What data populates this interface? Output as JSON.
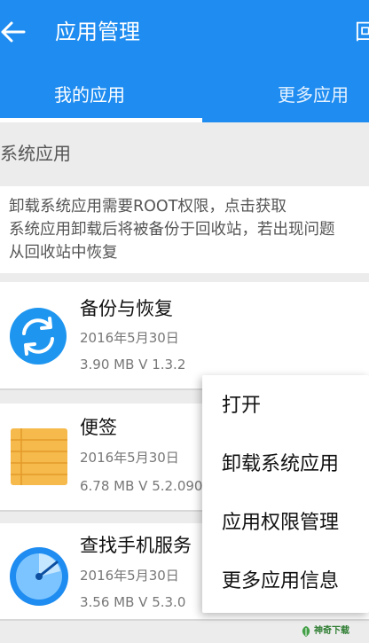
{
  "header": {
    "title": "应用管理",
    "right_action": "回",
    "back_icon": "arrow-left-icon"
  },
  "tabs": [
    {
      "label": "我的应用",
      "selected": true
    },
    {
      "label": "更多应用",
      "selected": false
    }
  ],
  "section": {
    "title": "系统应用"
  },
  "notice": {
    "line1": "卸载系统应用需要ROOT权限，点击获取",
    "line2": "系统应用卸载后将被备份于回收站，若出现问题",
    "line3": "从回收站中恢复"
  },
  "apps": [
    {
      "name": "备份与恢复",
      "date": "2016年5月30日",
      "size_version": "3.90 MB   V 1.3.2",
      "icon": "backup-restore-icon"
    },
    {
      "name": "便签",
      "date": "2016年5月30日",
      "size_version": "6.78 MB   V 5.2.090",
      "icon": "notepad-icon"
    },
    {
      "name": "查找手机服务",
      "date": "2016年5月30日",
      "size_version": "3.56 MB   V 5.3.0",
      "icon": "radar-icon"
    }
  ],
  "context_menu": {
    "items": [
      "打开",
      "卸载系统应用",
      "应用权限管理",
      "更多应用信息"
    ]
  },
  "watermark": {
    "text": "神奇下载",
    "icon": "leaf-logo-icon"
  },
  "colors": {
    "primary": "#1e8cf0",
    "background": "#ececec",
    "accent_orange": "#f5b94c",
    "accent_blue": "#1e8cf0"
  }
}
